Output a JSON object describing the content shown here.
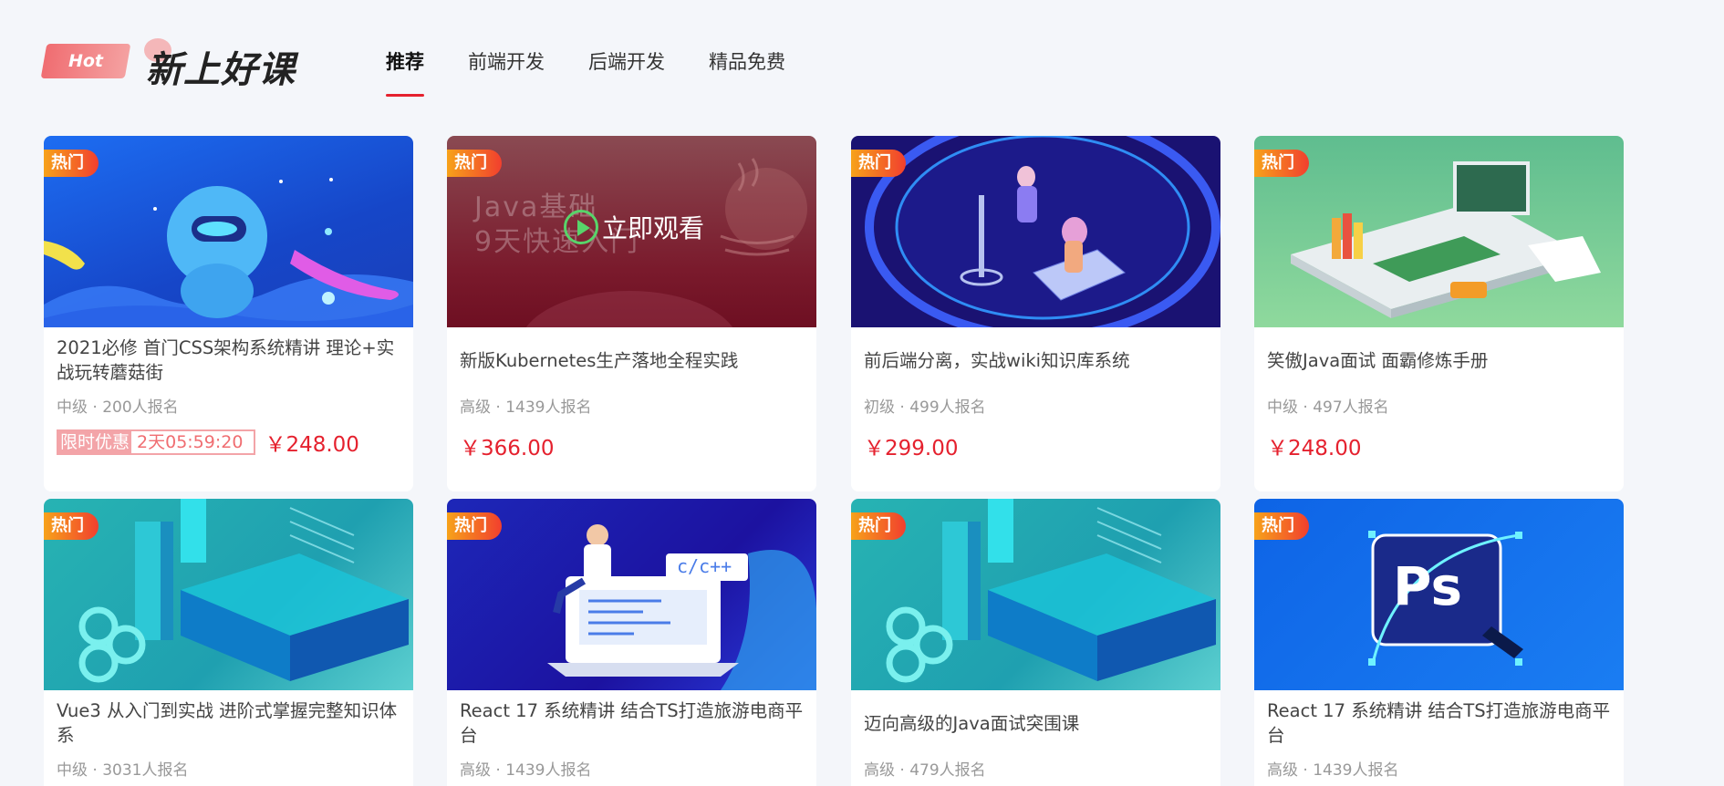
{
  "header": {
    "hot_label": "Hot",
    "title": "新上好课",
    "tabs": [
      {
        "label": "推荐",
        "active": true
      },
      {
        "label": "前端开发",
        "active": false
      },
      {
        "label": "后端开发",
        "active": false
      },
      {
        "label": "精品免费",
        "active": false
      }
    ]
  },
  "colors": {
    "accent": "#e5212e",
    "tag_gradient_start": "#f7a21a",
    "tag_gradient_end": "#f13f2e",
    "promo": "#f3a4a8"
  },
  "courses": [
    {
      "tag": "热门",
      "title": "2021必修 首门CSS架构系统精讲 理论+实战玩转蘑菇街",
      "meta": "中级 · 200人报名",
      "promo_label": "限时优惠",
      "promo_time": "2天05:59:20",
      "price": "￥248.00",
      "thumb": "robot-illustration"
    },
    {
      "tag": "热门",
      "title": "新版Kubernetes生产落地全程实践",
      "meta": "高级 · 1439人报名",
      "price": "￥366.00",
      "thumb": "java-video",
      "overlay_text": "Java基础",
      "overlay_text2": "9天快速入门",
      "watch_label": "立即观看"
    },
    {
      "tag": "热门",
      "title": "前后端分离，实战wiki知识库系统",
      "meta": "初级 · 499人报名",
      "price": "￥299.00",
      "thumb": "stage-illustration"
    },
    {
      "tag": "热门",
      "title": "笑傲Java面试 面霸修炼手册",
      "meta": "中级 · 497人报名",
      "price": "￥248.00",
      "thumb": "classroom-illustration"
    },
    {
      "tag": "热门",
      "title": "Vue3 从入门到实战 进阶式掌握完整知识体系",
      "meta": "中级 · 3031人报名",
      "thumb": "isometric-vue"
    },
    {
      "tag": "热门",
      "title": "React 17 系统精讲 结合TS打造旅游电商平台",
      "meta": "高级 · 1439人报名",
      "thumb": "laptop-code",
      "code_label": "c/c++"
    },
    {
      "tag": "热门",
      "title": "迈向高级的Java面试突围课",
      "meta": "高级 · 479人报名",
      "thumb": "isometric-vue"
    },
    {
      "tag": "热门",
      "title": "React 17 系统精讲 结合TS打造旅游电商平台",
      "meta": "高级 · 1439人报名",
      "thumb": "ps-icon",
      "ps_label": "Ps"
    }
  ]
}
